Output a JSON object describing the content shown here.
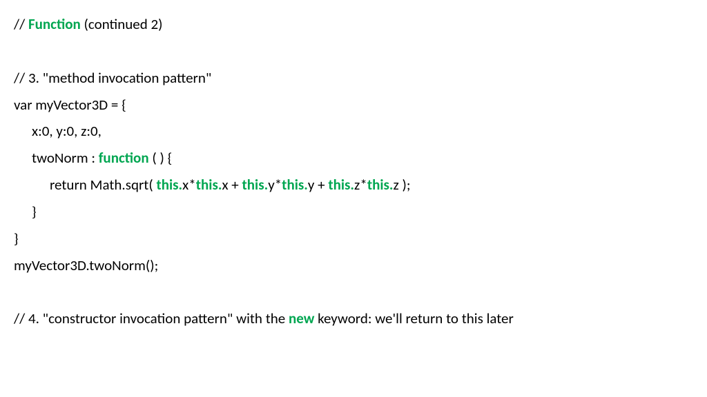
{
  "lines": {
    "l1_a": "// ",
    "l1_b": "Function",
    "l1_c": " (continued 2)",
    "l2_a": "// 3. \"method invocation pattern\"",
    "l3_a": "var myVector3D = {",
    "l4_a": "x:0, y:0, z:0,",
    "l5_a": "twoNorm : ",
    "l5_b": "function",
    "l5_c": " ( ) {",
    "l6_a": "return Math.sqrt( ",
    "l6_t1": "this.",
    "l6_x1": "x*",
    "l6_t2": "this.",
    "l6_x2": "x + ",
    "l6_t3": "this.",
    "l6_y1": "y*",
    "l6_t4": "this.",
    "l6_y2": "y + ",
    "l6_t5": "this.",
    "l6_z1": "z*",
    "l6_t6": "this.",
    "l6_z2": "z );",
    "l7_a": "}",
    "l8_a": "}",
    "l9_a": "myVector3D.twoNorm();",
    "l10_a": "// 4. \"constructor invocation pattern\" with the ",
    "l10_b": "new",
    "l10_c": " keyword: we'll return to this later"
  }
}
